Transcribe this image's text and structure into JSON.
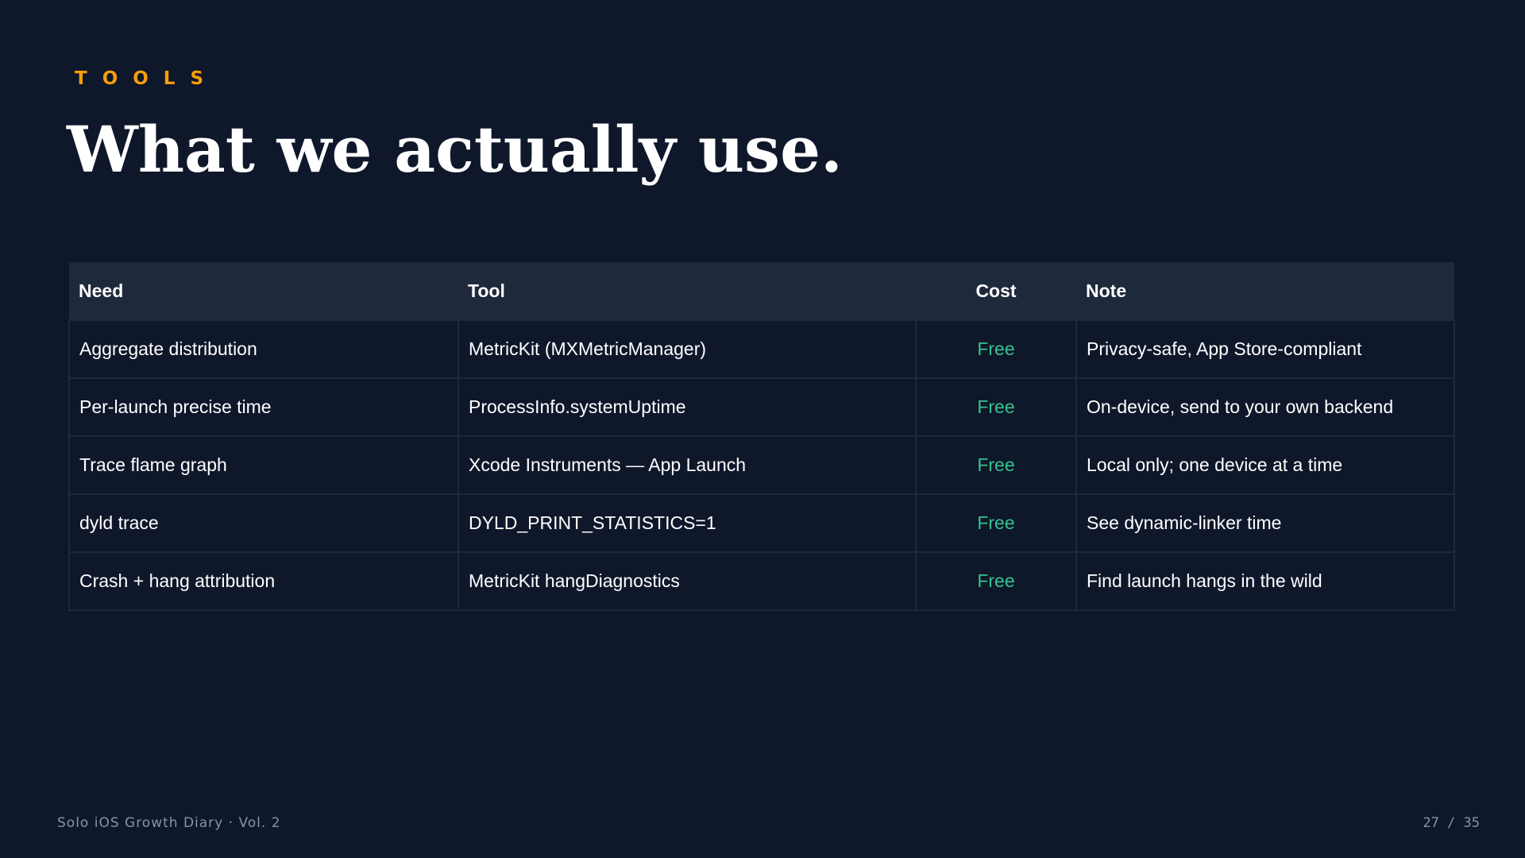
{
  "colors": {
    "background": "#0f172a",
    "accent": "#f59e0b",
    "header_row": "#1e293b",
    "free": "#34c38f",
    "muted": "#8a94a6"
  },
  "slide": {
    "eyebrow": "TOOLS",
    "title": "What we actually use."
  },
  "table": {
    "headers": [
      "Need",
      "Tool",
      "Cost",
      "Note"
    ],
    "rows": [
      [
        "Aggregate distribution",
        "MetricKit (MXMetricManager)",
        "Free",
        "Privacy-safe, App Store-compliant"
      ],
      [
        "Per-launch precise time",
        "ProcessInfo.systemUptime",
        "Free",
        "On-device, send to your own backend"
      ],
      [
        "Trace flame graph",
        "Xcode Instruments — App Launch",
        "Free",
        "Local only; one device at a time"
      ],
      [
        "dyld trace",
        "DYLD_PRINT_STATISTICS=1",
        "Free",
        "See dynamic-linker time"
      ],
      [
        "Crash + hang attribution",
        "MetricKit hangDiagnostics",
        "Free",
        "Find launch hangs in the wild"
      ]
    ]
  },
  "footer": {
    "deck_title": "Solo iOS Growth Diary · Vol. 2",
    "page_indicator": "27 / 35"
  }
}
